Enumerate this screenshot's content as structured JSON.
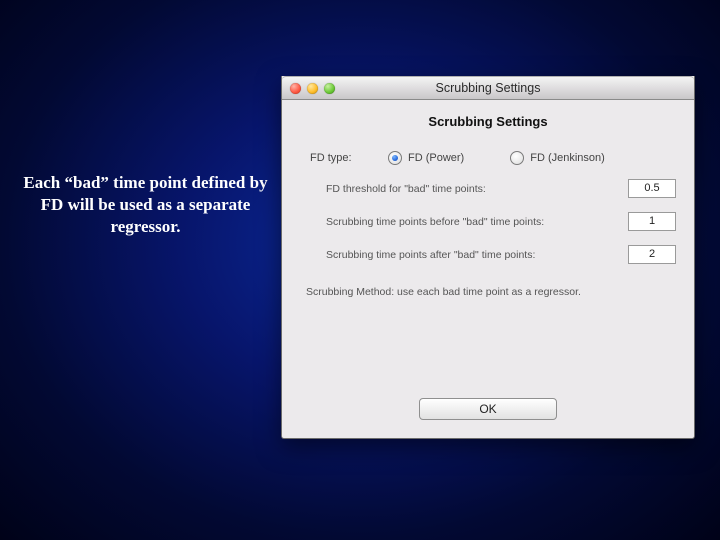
{
  "caption": "Each “bad” time point defined by FD will be used as a separate regressor.",
  "window": {
    "title": "Scrubbing Settings",
    "heading": "Scrubbing Settings",
    "fd_type": {
      "label": "FD type:",
      "option_power": "FD (Power)",
      "option_jenkinson": "FD (Jenkinson)",
      "selected": "power"
    },
    "threshold": {
      "label": "FD threshold for \"bad\" time points:",
      "value": "0.5"
    },
    "before": {
      "label": "Scrubbing time points before \"bad\" time points:",
      "value": "1"
    },
    "after": {
      "label": "Scrubbing time points after \"bad\" time points:",
      "value": "2"
    },
    "method_note": "Scrubbing Method: use each bad time point as a regressor.",
    "ok_label": "OK"
  }
}
